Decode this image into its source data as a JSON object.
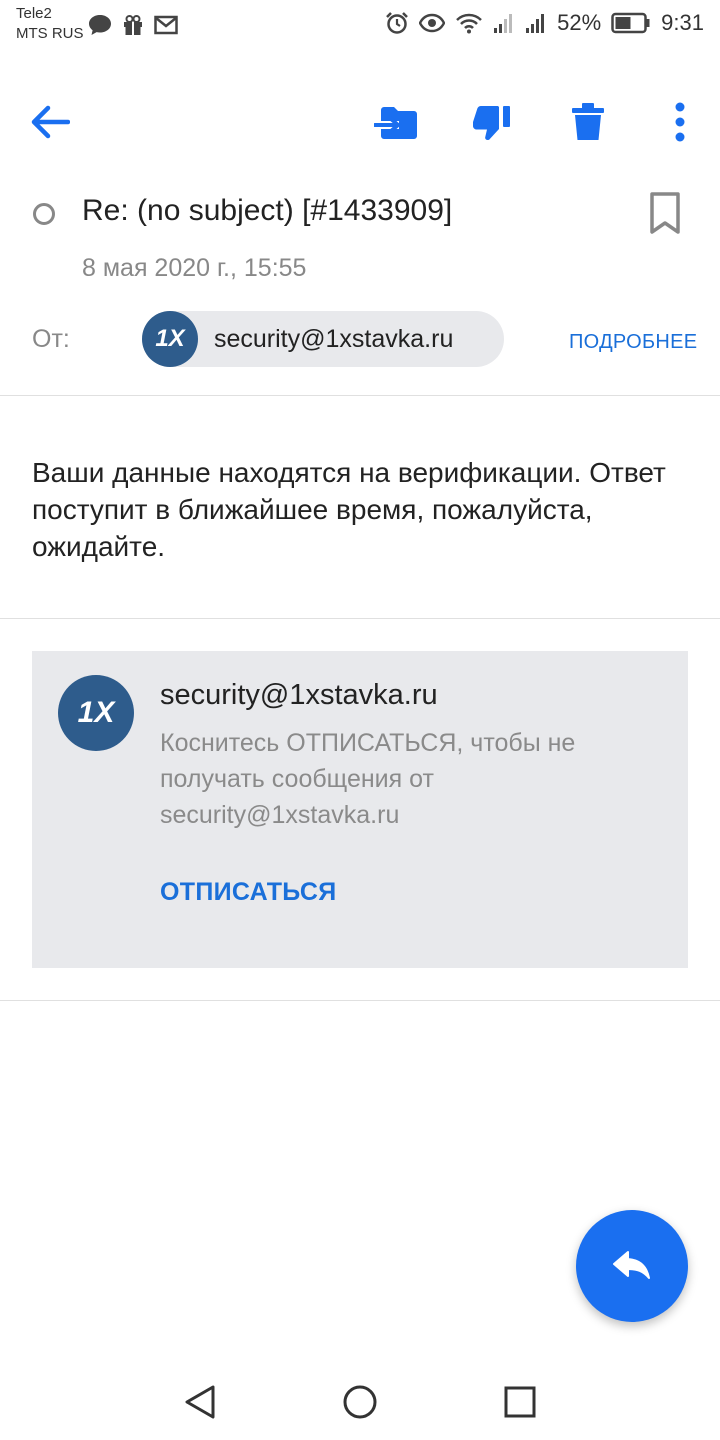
{
  "status_bar": {
    "carrier1": "Tele2",
    "carrier2": "MTS RUS",
    "battery": "52%",
    "time": "9:31"
  },
  "toolbar": {
    "icons": [
      "back-arrow-icon",
      "move-to-folder-icon",
      "spam-thumbs-down-icon",
      "trash-icon",
      "more-vert-icon"
    ]
  },
  "email": {
    "subject": "Re: (no subject) [#1433909]",
    "date": "8 мая 2020 г., 15:55",
    "from_label": "От:",
    "sender": "security@1xstavka.ru",
    "details_label": "ПОДРОБНЕЕ",
    "avatar_text": "1X",
    "body": "Ваши данные находятся на верификации. Ответ поступит в ближайшее время, пожалуйста, ожидайте."
  },
  "unsubscribe_card": {
    "avatar_text": "1X",
    "sender": "security@1xstavka.ru",
    "text": "Коснитесь ОТПИСАТЬСЯ, чтобы не получать сообщения от security@1xstavka.ru",
    "button_label": "ОТПИСАТЬСЯ"
  },
  "colors": {
    "accent": "#1a6ff0",
    "link": "#1a6fd9",
    "avatar_bg": "#2e5c8c",
    "card_bg": "#e8e9ec"
  }
}
